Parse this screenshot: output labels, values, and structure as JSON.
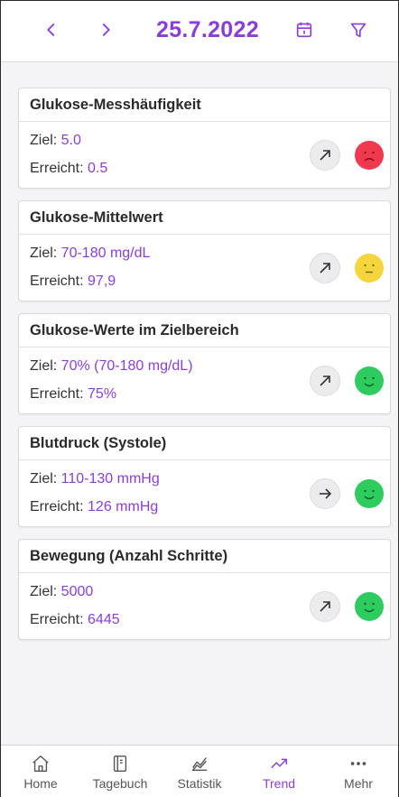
{
  "header": {
    "date": "25.7.2022"
  },
  "cards": [
    {
      "title": "Glukose-Messhäufigkeit",
      "target_label": "Ziel: ",
      "target_value": "5.0",
      "achieved_label": "Erreicht: ",
      "achieved_value": "0.5",
      "trend_icon": "arrow-up-right-icon",
      "status": "sad",
      "status_color": "#f0384f"
    },
    {
      "title": "Glukose-Mittelwert",
      "target_label": "Ziel: ",
      "target_value": "70-180 mg/dL",
      "achieved_label": "Erreicht: ",
      "achieved_value": "97,9",
      "trend_icon": "arrow-up-right-icon",
      "status": "neutral",
      "status_color": "#f5d53b"
    },
    {
      "title": "Glukose-Werte im Zielbereich",
      "target_label": "Ziel: ",
      "target_value": "70% (70-180 mg/dL)",
      "achieved_label": "Erreicht: ",
      "achieved_value": "75%",
      "trend_icon": "arrow-up-right-icon",
      "status": "happy",
      "status_color": "#2ecc5f"
    },
    {
      "title": "Blutdruck (Systole)",
      "target_label": "Ziel: ",
      "target_value": "110-130 mmHg",
      "achieved_label": "Erreicht: ",
      "achieved_value": "126 mmHg",
      "trend_icon": "arrow-right-icon",
      "status": "happy",
      "status_color": "#2ecc5f"
    },
    {
      "title": "Bewegung (Anzahl Schritte)",
      "target_label": "Ziel: ",
      "target_value": "5000",
      "achieved_label": "Erreicht: ",
      "achieved_value": "6445",
      "trend_icon": "arrow-up-right-icon",
      "status": "happy",
      "status_color": "#2ecc5f"
    }
  ],
  "tabs": [
    {
      "label": "Home",
      "icon": "home-icon",
      "active": false
    },
    {
      "label": "Tagebuch",
      "icon": "notebook-icon",
      "active": false
    },
    {
      "label": "Statistik",
      "icon": "statistics-icon",
      "active": false
    },
    {
      "label": "Trend",
      "icon": "trend-icon",
      "active": true
    },
    {
      "label": "Mehr",
      "icon": "more-icon",
      "active": false
    }
  ],
  "colors": {
    "accent": "#8a3ddb",
    "sad": "#f0384f",
    "neutral": "#f5d53b",
    "happy": "#2ecc5f"
  }
}
